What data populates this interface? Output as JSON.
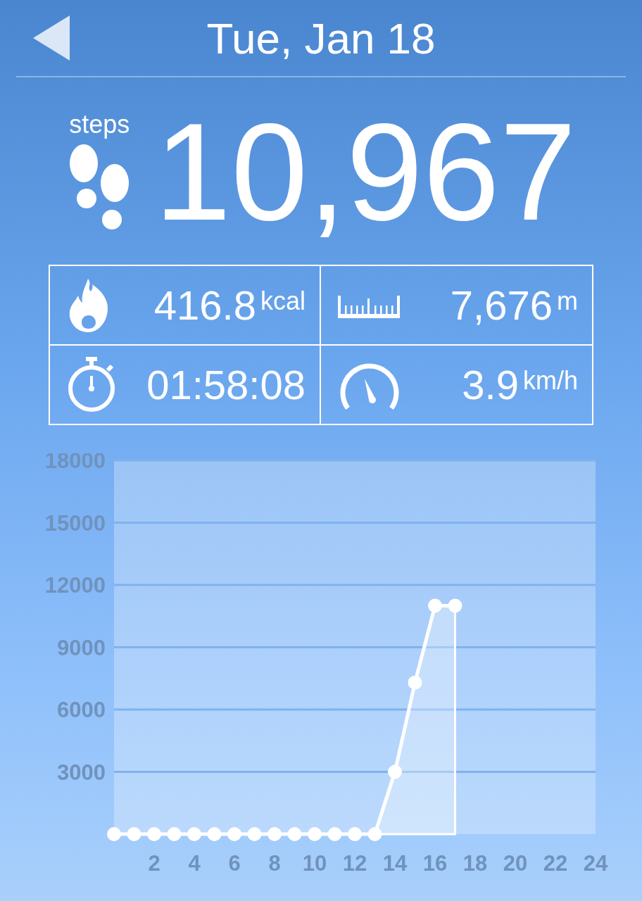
{
  "header": {
    "title": "Tue, Jan 18"
  },
  "summary": {
    "label": "steps",
    "value": "10,967"
  },
  "stats": [
    {
      "kind": "calories",
      "value": "416.8",
      "unit": "kcal"
    },
    {
      "kind": "distance",
      "value": "7,676",
      "unit": "m"
    },
    {
      "kind": "duration",
      "value": "01:58:08"
    },
    {
      "kind": "speed",
      "value": "3.9",
      "unit": "km/h"
    }
  ],
  "chart": {
    "chart_data": {
      "type": "area",
      "x": [
        0,
        1,
        2,
        3,
        4,
        5,
        6,
        7,
        8,
        9,
        10,
        11,
        12,
        13,
        14,
        15,
        16,
        17
      ],
      "series": [
        {
          "color": "#ffffff",
          "values": [
            0,
            0,
            0,
            0,
            0,
            0,
            0,
            0,
            0,
            0,
            0,
            0,
            0,
            0,
            3000,
            7300,
            11000,
            11000
          ]
        }
      ],
      "grid": true,
      "xlim": [
        0,
        24
      ],
      "ylim": [
        0,
        18000
      ],
      "xticks": [
        2,
        4,
        6,
        8,
        10,
        12,
        14,
        16,
        18,
        20,
        22,
        24
      ],
      "yticks": [
        3000,
        6000,
        9000,
        12000,
        15000,
        18000
      ]
    }
  }
}
